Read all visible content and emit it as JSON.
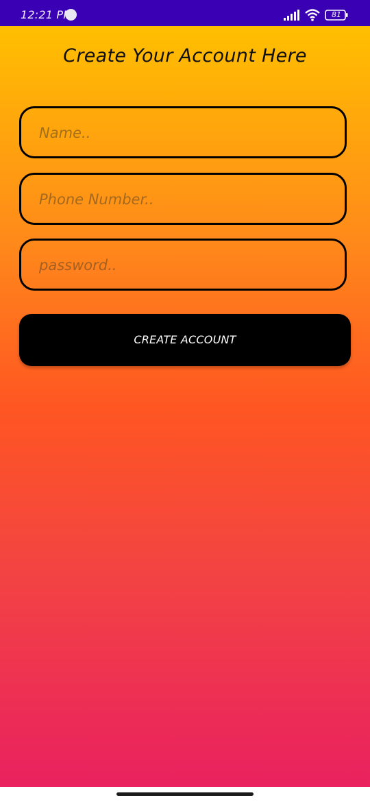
{
  "status_bar": {
    "time": "12:21 PM",
    "battery_level": "81",
    "icons": [
      "signal-icon",
      "wifi-icon",
      "battery-icon"
    ]
  },
  "form": {
    "title": "Create Your Account Here",
    "name_placeholder": "Name..",
    "phone_placeholder": "Phone Number..",
    "password_placeholder": "password..",
    "submit_label": "CREATE ACCOUNT"
  },
  "colors": {
    "status_bar_bg": "#3a00b3",
    "gradient_top": "#ffbf00",
    "gradient_mid": "#ff5622",
    "gradient_bottom": "#e9215f",
    "button_bg": "#000000",
    "button_text": "#ffffff"
  }
}
